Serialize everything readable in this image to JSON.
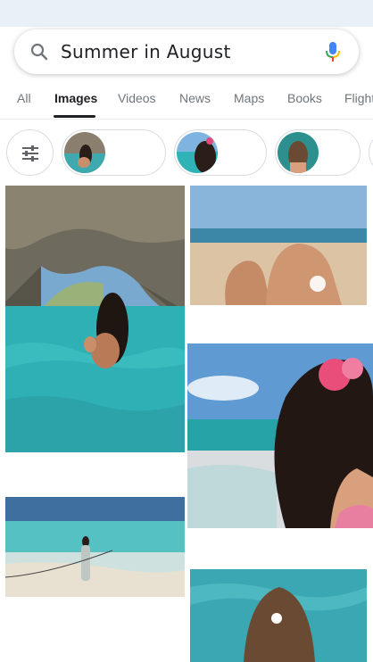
{
  "search": {
    "query": "Summer in August"
  },
  "tabs": [
    {
      "label": "All",
      "active": false
    },
    {
      "label": "Images",
      "active": true
    },
    {
      "label": "Videos",
      "active": false
    },
    {
      "label": "News",
      "active": false
    },
    {
      "label": "Maps",
      "active": false
    },
    {
      "label": "Books",
      "active": false
    },
    {
      "label": "Flights",
      "active": false
    }
  ],
  "chips": {
    "filter_icon": "tune-sliders-icon",
    "suggestions": [
      "chip-1",
      "chip-2",
      "chip-3",
      "chip-4"
    ]
  },
  "results": [
    {
      "name": "image-result-cave-swimmer",
      "scene": "cave"
    },
    {
      "name": "image-result-beach-knee",
      "scene": "beach-knee"
    },
    {
      "name": "image-result-flower-hair",
      "scene": "flower"
    },
    {
      "name": "image-result-shore-woman",
      "scene": "shore"
    },
    {
      "name": "image-result-water-hair",
      "scene": "waterhair"
    }
  ],
  "colors": {
    "accent": "#202124",
    "muted": "#70757a",
    "mic_blue": "#4285f4",
    "mic_red": "#ea4335",
    "mic_yellow": "#fbbc05",
    "mic_green": "#34a853"
  }
}
